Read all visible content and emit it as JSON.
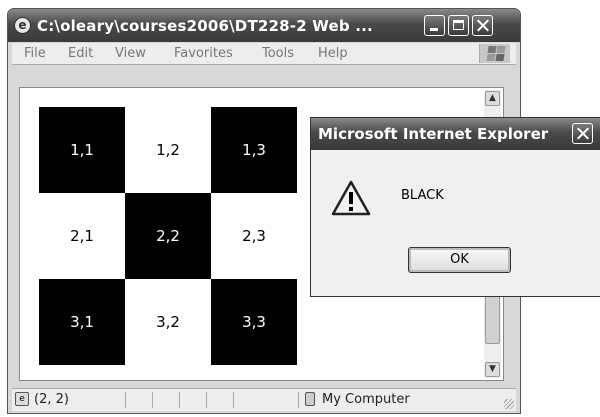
{
  "window": {
    "title": "C:\\oleary\\courses2006\\DT228-2 Web ...",
    "menu": [
      "File",
      "Edit",
      "View",
      "Favorites",
      "Tools",
      "Help"
    ]
  },
  "grid": {
    "rows": [
      [
        {
          "label": "1,1",
          "color": "black"
        },
        {
          "label": "1,2",
          "color": "white"
        },
        {
          "label": "1,3",
          "color": "black"
        }
      ],
      [
        {
          "label": "2,1",
          "color": "white"
        },
        {
          "label": "2,2",
          "color": "black"
        },
        {
          "label": "2,3",
          "color": "white"
        }
      ],
      [
        {
          "label": "3,1",
          "color": "black"
        },
        {
          "label": "3,2",
          "color": "white"
        },
        {
          "label": "3,3",
          "color": "black"
        }
      ]
    ]
  },
  "statusbar": {
    "text": "(2, 2)",
    "zone": "My Computer"
  },
  "dialog": {
    "title": "Microsoft Internet Explorer",
    "message": "BLACK",
    "ok_label": "OK"
  },
  "icons": {
    "app": "ie-page-icon",
    "logo": "windows-logo",
    "dialog": "warning-icon",
    "status": "page-icon",
    "zone": "computer-icon"
  }
}
